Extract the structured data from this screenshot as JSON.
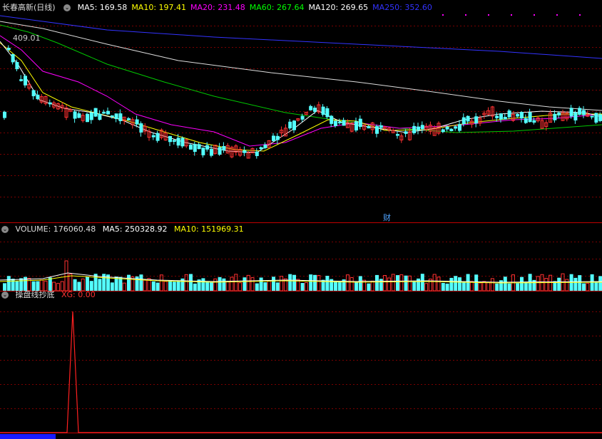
{
  "main": {
    "title": "长春高新(日线)",
    "ma": [
      {
        "label": "MA5: 169.58",
        "color": "#ffffff"
      },
      {
        "label": "MA10: 197.41",
        "color": "#ffff00"
      },
      {
        "label": "MA20: 231.48",
        "color": "#ff00ff"
      },
      {
        "label": "MA60: 267.64",
        "color": "#00ff00"
      },
      {
        "label": "MA120: 269.65",
        "color": "#ffffff"
      },
      {
        "label": "MA250: 352.60",
        "color": "#3333ff"
      }
    ],
    "max_label": "409.01",
    "event_marker": "财"
  },
  "volume": {
    "label": "VOLUME: 176060.48",
    "ma5": "MA5: 250328.92",
    "ma10": "MA10: 151969.31"
  },
  "indicator": {
    "label": "操盘线抄底",
    "xg": "XG: 0.00"
  },
  "chart_data": [
    {
      "type": "line",
      "title": "长春高新(日线)",
      "series": [
        {
          "name": "MA5",
          "last": 169.58
        },
        {
          "name": "MA10",
          "last": 197.41
        },
        {
          "name": "MA20",
          "last": 231.48
        },
        {
          "name": "MA60",
          "last": 267.64
        },
        {
          "name": "MA120",
          "last": 269.65
        },
        {
          "name": "MA250",
          "last": 352.6
        }
      ],
      "annotations": [
        "409.01"
      ]
    },
    {
      "type": "bar",
      "title": "VOLUME",
      "values": {
        "VOLUME": 176060.48,
        "MA5": 250328.92,
        "MA10": 151969.31
      }
    },
    {
      "type": "line",
      "title": "操盘线抄底",
      "series": [
        {
          "name": "XG",
          "last": 0.0
        }
      ]
    }
  ]
}
